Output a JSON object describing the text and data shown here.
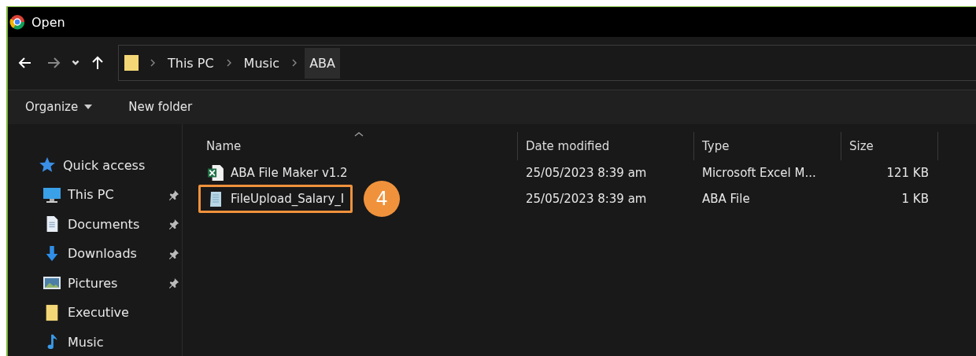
{
  "window": {
    "title": "Open"
  },
  "breadcrumb": [
    "This PC",
    "Music",
    "ABA"
  ],
  "toolbar": {
    "organize": "Organize",
    "new_folder": "New folder"
  },
  "sidebar": {
    "items": [
      {
        "label": "Quick access",
        "kind": "star",
        "pinned": false
      },
      {
        "label": "This PC",
        "kind": "pc",
        "pinned": true
      },
      {
        "label": "Documents",
        "kind": "doc",
        "pinned": true
      },
      {
        "label": "Downloads",
        "kind": "download",
        "pinned": true
      },
      {
        "label": "Pictures",
        "kind": "pictures",
        "pinned": true
      },
      {
        "label": "Executive",
        "kind": "folder",
        "pinned": false
      },
      {
        "label": "Music",
        "kind": "music",
        "pinned": false
      }
    ]
  },
  "table": {
    "columns": [
      "Name",
      "Date modified",
      "Type",
      "Size"
    ],
    "rows": [
      {
        "name": "ABA File Maker v1.2",
        "kind": "excel",
        "date": "25/05/2023 8:39 am",
        "type": "Microsoft Excel M...",
        "size": "121 KB",
        "highlighted": false
      },
      {
        "name": "FileUpload_Salary_I",
        "kind": "text",
        "date": "25/05/2023 8:39 am",
        "type": "ABA File",
        "size": "1 KB",
        "highlighted": true,
        "callout": "4"
      }
    ]
  }
}
